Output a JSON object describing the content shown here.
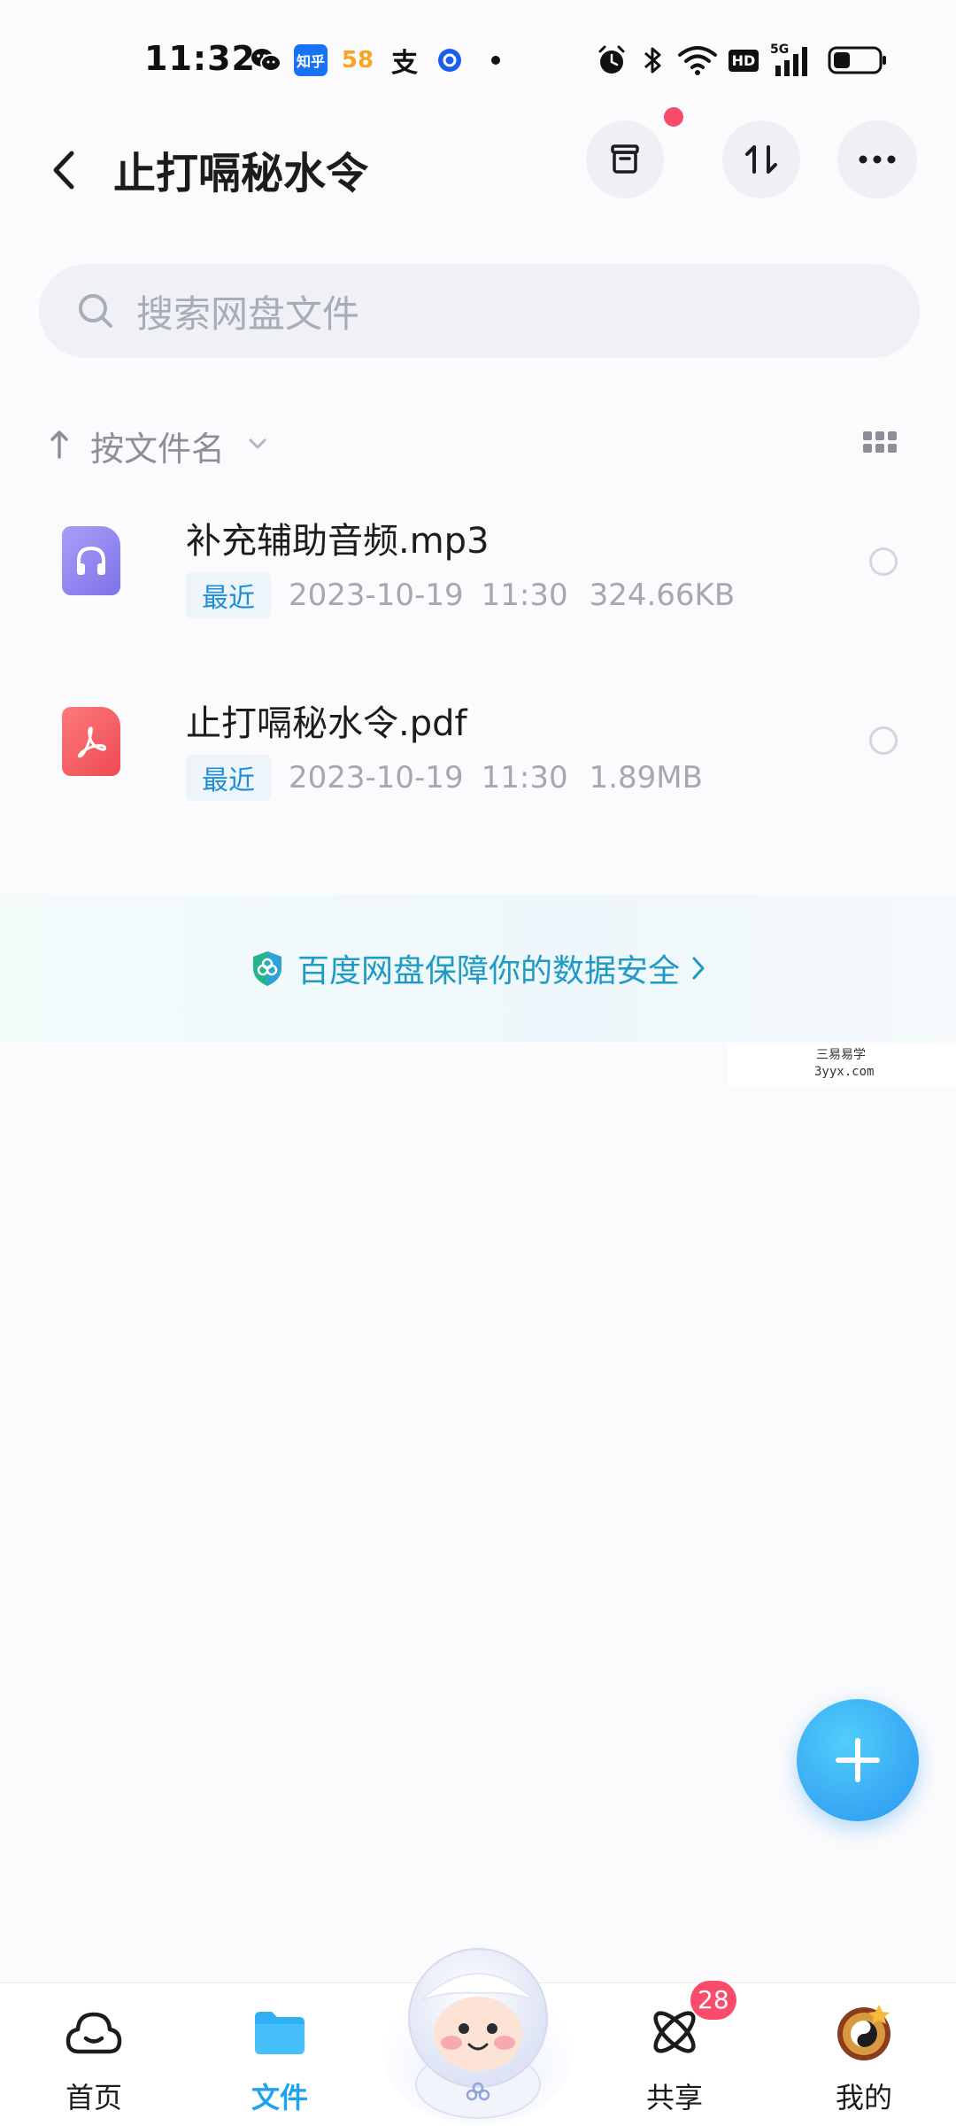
{
  "status_bar": {
    "time": "11:32",
    "app_badges": [
      "wechat-icon",
      "zhihu-icon",
      "58-icon",
      "alipay-icon",
      "app-circle-icon",
      "dot-icon"
    ],
    "zhihu_label": "知乎",
    "app58_label": "58",
    "alipay_label": "支",
    "right_icons": [
      "alarm-icon",
      "bluetooth-icon",
      "wifi-icon",
      "hd-icon",
      "signal-5g-icon",
      "battery-icon"
    ],
    "hd_label": "HD",
    "signal_label": "5G"
  },
  "header": {
    "title": "止打嗝秘水令",
    "actions": [
      "archive-icon",
      "transfer-icon",
      "more-icon"
    ]
  },
  "search": {
    "placeholder": "搜索网盘文件"
  },
  "sort": {
    "label": "按文件名"
  },
  "files": [
    {
      "name": "补充辅助音频.mp3",
      "badge": "最近",
      "date": "2023-10-19",
      "time": "11:30",
      "size": "324.66KB",
      "type": "audio",
      "icon_color": "#8f85f0"
    },
    {
      "name": "止打嗝秘水令.pdf",
      "badge": "最近",
      "date": "2023-10-19",
      "time": "11:30",
      "size": "1.89MB",
      "type": "pdf",
      "icon_color": "#f4585d"
    }
  ],
  "security_banner": {
    "text": "百度网盘保障你的数据安全"
  },
  "watermark": {
    "cn": "三易易学",
    "url": "3yyx.com"
  },
  "bottom_nav": {
    "items": [
      {
        "label": "首页",
        "active": false
      },
      {
        "label": "文件",
        "active": true
      },
      {
        "label": "共享",
        "active": false,
        "badge": "28"
      },
      {
        "label": "我的",
        "active": false
      }
    ]
  },
  "colors": {
    "accent": "#1ea3f0",
    "badge_red": "#fb4b6b",
    "security_teal": "#1d9bc4"
  }
}
